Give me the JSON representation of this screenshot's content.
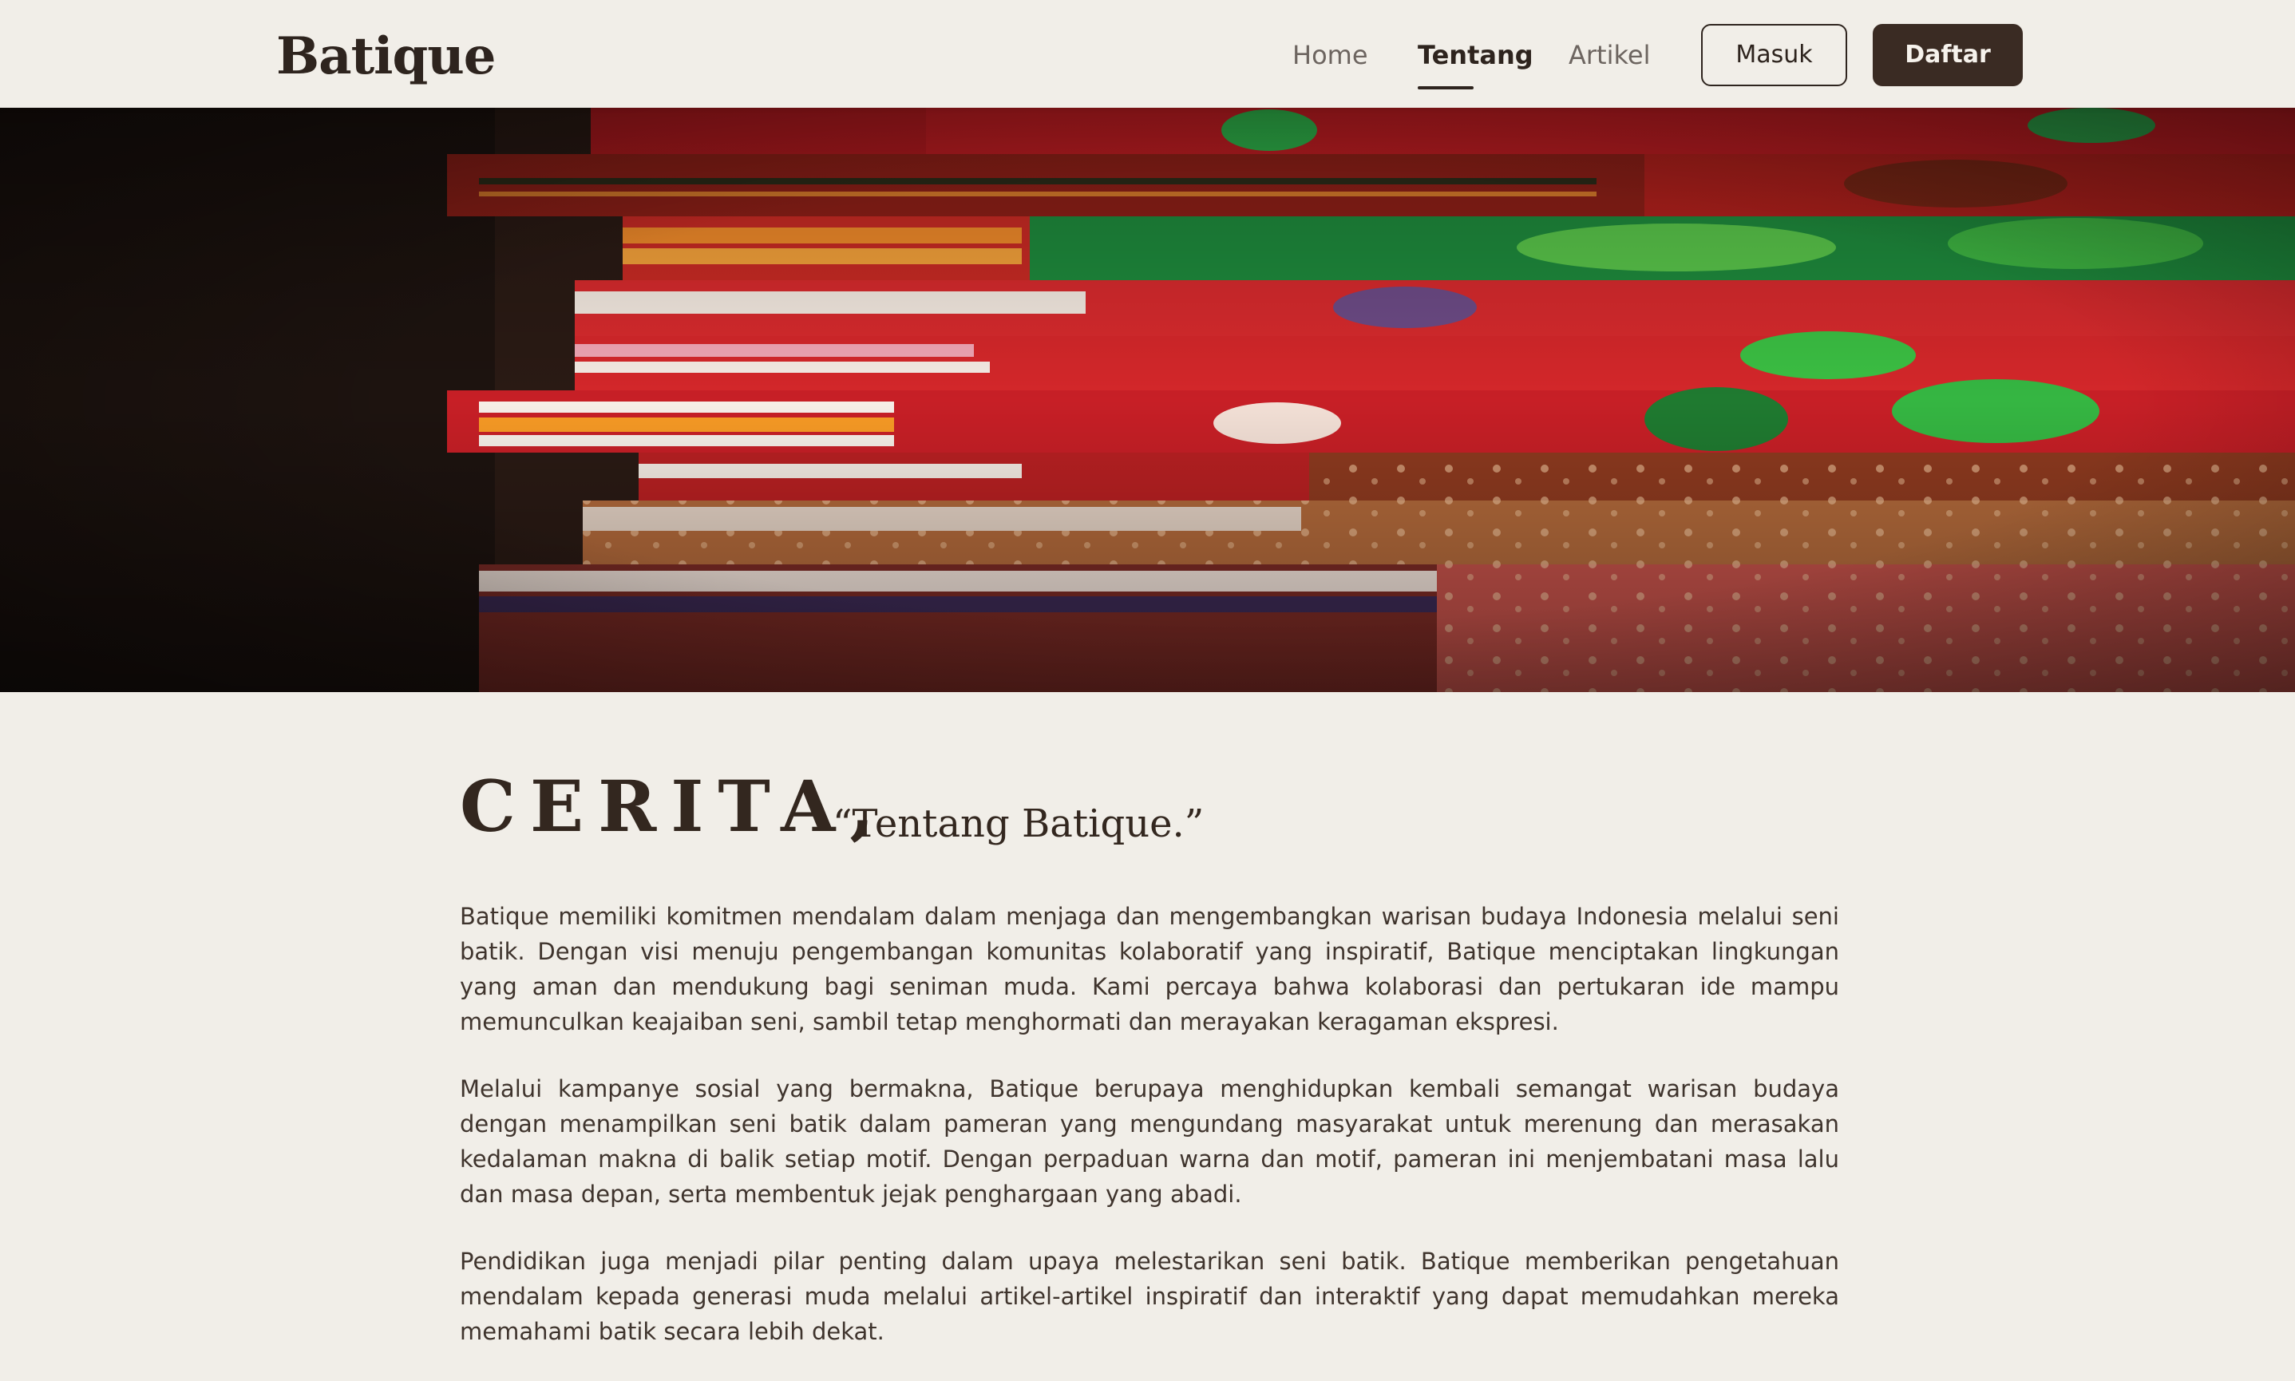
{
  "nav": {
    "brand": "Batique",
    "links": [
      {
        "label": "Home"
      },
      {
        "label": "Tentang"
      },
      {
        "label": "Artikel"
      }
    ],
    "login_label": "Masuk",
    "register_label": "Daftar"
  },
  "hero": {
    "image": "stack-of-folded-batik-fabrics"
  },
  "story": {
    "heading": "CERITA,",
    "subheading": "“Tentang Batique.”",
    "paragraphs": [
      "Batique memiliki komitmen mendalam dalam menjaga dan mengembangkan warisan budaya Indonesia melalui seni batik. Dengan visi menuju pengembangan komunitas kolaboratif yang inspiratif, Batique menciptakan lingkungan yang aman dan mendukung bagi seniman muda. Kami percaya bahwa kolaborasi dan pertukaran ide mampu memunculkan keajaiban seni, sambil tetap menghormati dan merayakan keragaman ekspresi.",
      "Melalui kampanye sosial yang bermakna, Batique berupaya menghidupkan kembali semangat warisan budaya dengan menampilkan seni batik dalam pameran yang mengundang masyarakat untuk merenung dan merasakan kedalaman makna di balik setiap motif. Dengan perpaduan warna dan motif, pameran ini menjembatani masa lalu dan masa depan, serta membentuk jejak penghargaan yang abadi.",
      "Pendidikan juga menjadi pilar penting dalam upaya melestarikan seni batik. Batique memberikan pengetahuan mendalam kepada generasi muda melalui artikel-artikel inspiratif dan interaktif yang dapat memudahkan mereka memahami batik secara lebih dekat."
    ]
  },
  "colors": {
    "background": "#f1eee8",
    "text": "#3a2e27",
    "accent": "#3a2b23"
  }
}
